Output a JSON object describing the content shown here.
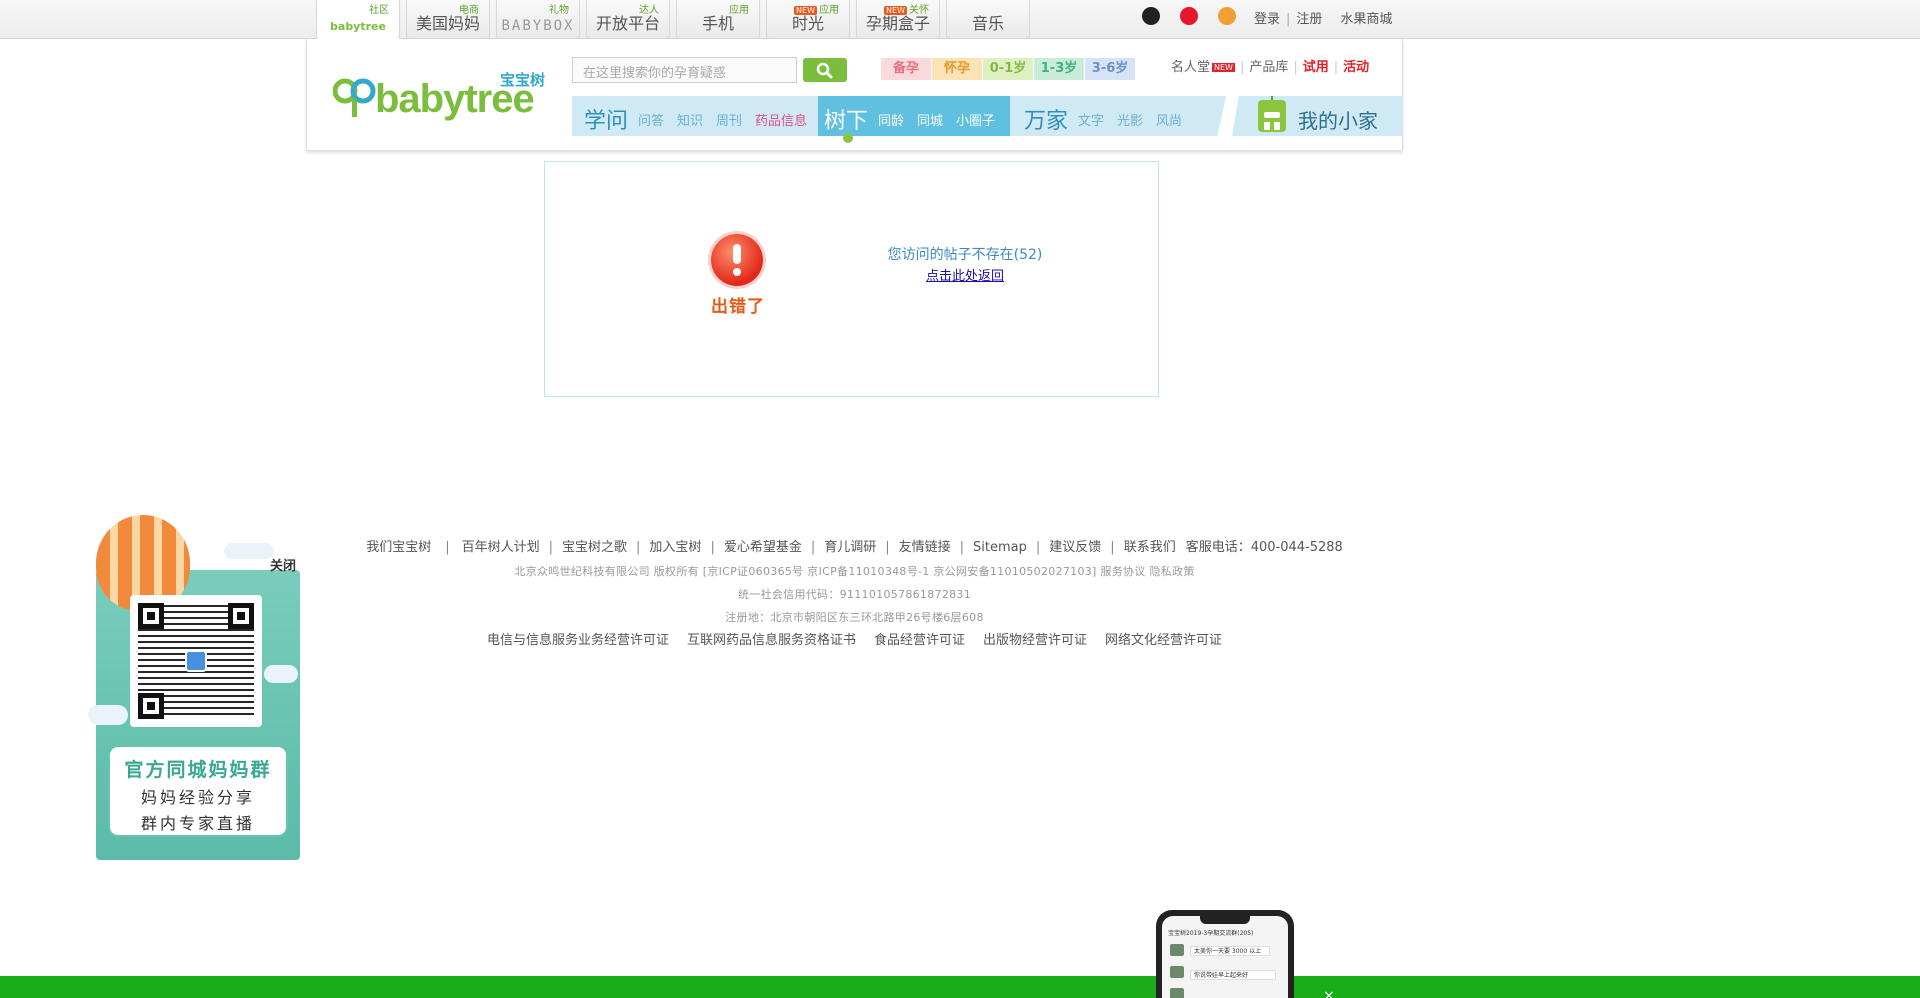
{
  "topbar": {
    "tabs": [
      {
        "tag": "社区",
        "name": "babytree",
        "style": "logo"
      },
      {
        "tag": "电商",
        "name": "美国妈妈",
        "style": ""
      },
      {
        "tag": "礼物",
        "name": "BABYBOX",
        "style": "box"
      },
      {
        "tag": "达人",
        "name": "开放平台",
        "style": ""
      },
      {
        "tag": "应用",
        "name": "手机",
        "style": ""
      },
      {
        "tag": "应用",
        "tag_new": "NEW",
        "name": "时光",
        "style": ""
      },
      {
        "tag": "关怀",
        "tag_new": "NEW",
        "name": "孕期盒子",
        "style": ""
      },
      {
        "tag": "",
        "name": "音乐",
        "style": ""
      }
    ],
    "social_icons": [
      "qq-icon",
      "weibo-icon",
      "renren-icon"
    ],
    "links": {
      "login": "登录",
      "register": "注册",
      "mall": "水果商城"
    }
  },
  "header": {
    "logo": {
      "sub": "宝宝树",
      "main": "babytree"
    },
    "search_placeholder": "在这里搜索你的孕育疑惑",
    "stages": [
      {
        "label": "备孕",
        "bg": "#f9d9dc",
        "color": "#e4737d"
      },
      {
        "label": "怀孕",
        "bg": "#fbe3b7",
        "color": "#e79a2a"
      },
      {
        "label": "0-1岁",
        "bg": "#def0c2",
        "color": "#86b745"
      },
      {
        "label": "1-3岁",
        "bg": "#c9ecd9",
        "color": "#3fb080"
      },
      {
        "label": "3-6岁",
        "bg": "#d6e3f5",
        "color": "#6f8fcb"
      }
    ],
    "links": {
      "celebrity": "名人堂",
      "new": "NEW",
      "products": "产品库",
      "trial": "试用",
      "activity": "活动"
    },
    "nav": {
      "xuewen": {
        "title": "学问",
        "items": [
          "问答",
          "知识",
          "周刊",
          "药品信息"
        ]
      },
      "shuxia": {
        "title": "树下",
        "items": [
          "同龄",
          "同城",
          "小圈子"
        ]
      },
      "wanjia": {
        "title": "万家",
        "items": [
          "文字",
          "光影",
          "风尚"
        ]
      },
      "home": "我的小家"
    }
  },
  "error": {
    "label": "出错了",
    "message": "您访问的帖子不存在(52)",
    "back_link": "点击此处返回"
  },
  "footer": {
    "links": [
      "我们宝宝树",
      "百年树人计划",
      "宝宝树之歌",
      "加入宝树",
      "爱心希望基金",
      "育儿调研",
      "友情链接",
      "Sitemap",
      "建议反馈",
      "联系我们"
    ],
    "hotline": "客服电话：400-044-5288",
    "copyright": "北京众鸣世纪科技有限公司 版权所有 [京ICP证060365号 京ICP备11010348号-1 京公网安备11010502027103] 服务协议 隐私政策",
    "credit_code": "统一社会信用代码：911101057861872831",
    "address": "注册地：北京市朝阳区东三环北路甲26号楼6层608",
    "licenses": [
      "电信与信息服务业务经营许可证",
      "互联网药品信息服务资格证书",
      "食品经营许可证",
      "出版物经营许可证",
      "网络文化经营许可证"
    ]
  },
  "qr_popup": {
    "close": "关闭",
    "title": "官方同城妈妈群",
    "line1": "妈妈经验分享",
    "line2": "群内专家直播"
  },
  "phone_preview": {
    "header": "宝宝树2019-3孕期交流群(205)",
    "msg1": "太美你一天要 3000 以上",
    "msg2": "你说带娃早上起来好"
  },
  "bottom_bar": {
    "close": "×",
    "color": "#1aad19"
  }
}
